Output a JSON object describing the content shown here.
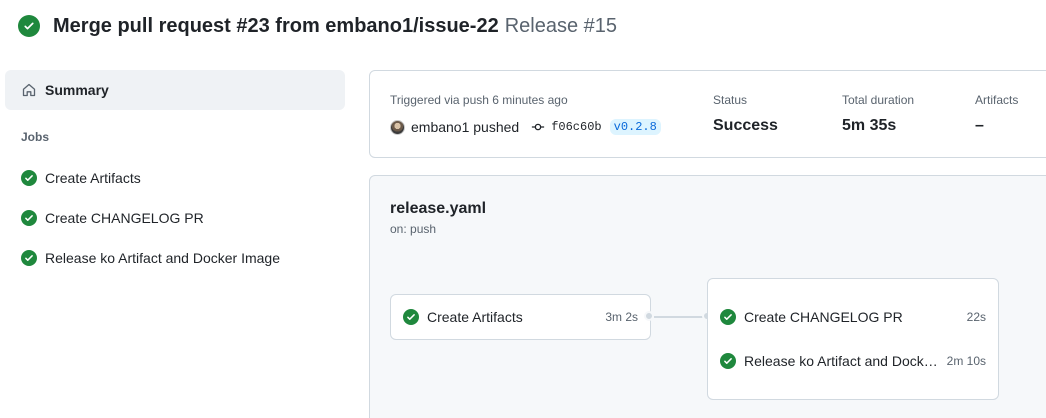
{
  "header": {
    "title": "Merge pull request #23 from embano1/issue-22",
    "subtitle": "Release #15",
    "status_icon": "check-circle-fill-icon"
  },
  "sidebar": {
    "summary_label": "Summary",
    "jobs_heading": "Jobs",
    "jobs": [
      {
        "label": "Create Artifacts",
        "status": "success"
      },
      {
        "label": "Create CHANGELOG PR",
        "status": "success"
      },
      {
        "label": "Release ko Artifact and Docker Image",
        "status": "success"
      }
    ]
  },
  "summary": {
    "trigger_label": "Triggered via push 6 minutes ago",
    "actor": "embano1 pushed",
    "commit_sha": "f06c60b",
    "tag": "v0.2.8",
    "status_label": "Status",
    "status_value": "Success",
    "duration_label": "Total duration",
    "duration_value": "5m 35s",
    "artifacts_label": "Artifacts",
    "artifacts_value": "–"
  },
  "workflow": {
    "name": "release.yaml",
    "trigger": "on: push",
    "stage1": [
      {
        "label": "Create Artifacts",
        "time": "3m 2s"
      }
    ],
    "stage2": [
      {
        "label": "Create CHANGELOG PR",
        "time": "22s"
      },
      {
        "label": "Release ko Artifact and Docker Image",
        "time": "2m 10s"
      }
    ]
  },
  "colors": {
    "success": "#1f883d",
    "accent": "#0969da",
    "muted": "#59636e",
    "border": "#d1d9e0"
  }
}
